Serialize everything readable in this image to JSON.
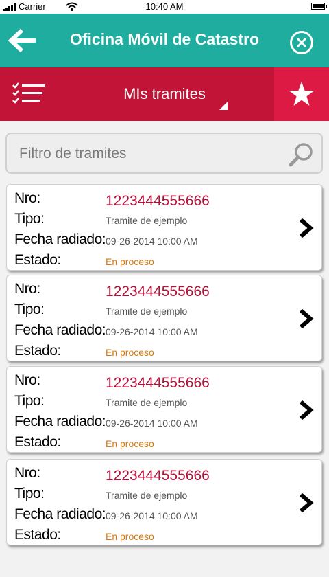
{
  "status_bar": {
    "carrier": "Carrier",
    "time": "10:40 AM"
  },
  "header": {
    "title": "Oficina Móvil de Catastro"
  },
  "subheader": {
    "title": "MIs tramites"
  },
  "search": {
    "placeholder": "Filtro de tramites"
  },
  "labels": {
    "nro": "Nro:",
    "tipo": "Tipo:",
    "fecha": "Fecha radiado:",
    "estado": "Estado:"
  },
  "tramites": [
    {
      "nro": "1223444555666",
      "tipo": "Tramite de ejemplo",
      "fecha": "09-26-2014 10:00 AM",
      "estado": "En proceso"
    },
    {
      "nro": "1223444555666",
      "tipo": "Tramite de ejemplo",
      "fecha": "09-26-2014 10:00 AM",
      "estado": "En proceso"
    },
    {
      "nro": "1223444555666",
      "tipo": "Tramite de ejemplo",
      "fecha": "09-26-2014 10:00 AM",
      "estado": "En proceso"
    },
    {
      "nro": "1223444555666",
      "tipo": "Tramite de ejemplo",
      "fecha": "09-26-2014 10:00 AM",
      "estado": "En proceso"
    }
  ],
  "colors": {
    "header": "#1fad9f",
    "subheader": "#c21437",
    "star_bg": "#dc1a43",
    "nro": "#b5123a",
    "estado": "#d9770a"
  },
  "icons": {
    "back": "arrow-left-icon",
    "close": "close-circle-icon",
    "list": "checklist-icon",
    "star": "star-icon",
    "search": "search-icon",
    "chevron": "chevron-right-icon"
  }
}
